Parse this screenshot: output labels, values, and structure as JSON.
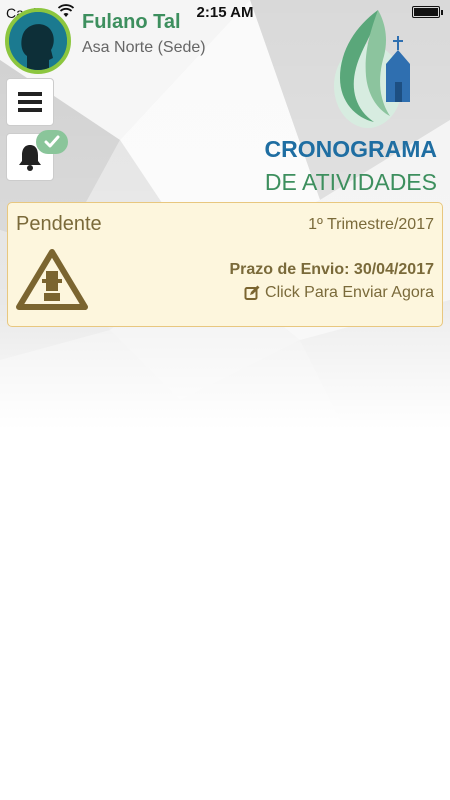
{
  "status_bar": {
    "carrier": "Carrier",
    "time": "2:15 AM"
  },
  "user": {
    "name": "Fulano Tal",
    "location": "Asa Norte (Sede)"
  },
  "header": {
    "title_line1": "CRONOGRAMA",
    "title_line2": "DE ATIVIDADES"
  },
  "card": {
    "status": "Pendente",
    "period": "1º Trimestre/2017",
    "deadline": "Prazo de Envio: 30/04/2017",
    "action": "Click Para Enviar Agora"
  },
  "icons": [
    "wifi-icon",
    "battery-icon",
    "avatar",
    "logo",
    "menu-icon",
    "bell-icon",
    "check-icon",
    "warning-icon",
    "edit-icon"
  ],
  "colors": {
    "green": "#3d8f5e",
    "blue": "#1f6ea2",
    "card_bg": "#fdf6dd",
    "card_border": "#e8c77f",
    "card_text": "#7a6a3a"
  }
}
